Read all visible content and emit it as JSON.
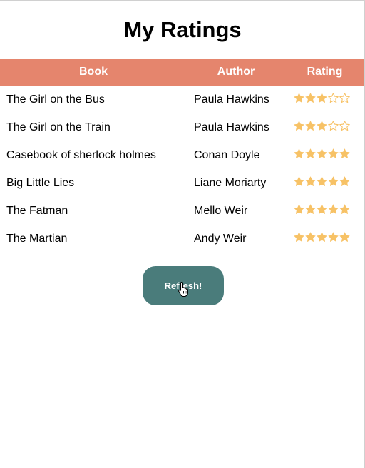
{
  "page": {
    "title": "My Ratings"
  },
  "table": {
    "headers": {
      "book": "Book",
      "author": "Author",
      "rating": "Rating"
    },
    "rows": [
      {
        "book": "The Girl on the Bus",
        "author": "Paula Hawkins",
        "rating": 3,
        "max_rating": 5
      },
      {
        "book": "The Girl on the Train",
        "author": "Paula Hawkins",
        "rating": 3,
        "max_rating": 5
      },
      {
        "book": "Casebook of sherlock holmes",
        "author": "Conan Doyle",
        "rating": 5,
        "max_rating": 5
      },
      {
        "book": "Big Little Lies",
        "author": "Liane Moriarty",
        "rating": 5,
        "max_rating": 5
      },
      {
        "book": "The Fatman",
        "author": "Mello Weir",
        "rating": 5,
        "max_rating": 5
      },
      {
        "book": "The Martian",
        "author": "Andy Weir",
        "rating": 5,
        "max_rating": 5
      }
    ]
  },
  "refresh_button": {
    "label": "Refresh!"
  },
  "icons": {
    "star_filled": "star-filled-icon",
    "star_empty": "star-empty-icon",
    "cursor": "hand-pointer-icon"
  },
  "colors": {
    "header_background": "#e5856d",
    "header_text": "#ffffff",
    "star": "#f7c266",
    "button_background": "#4a7c7b",
    "button_text": "#ffffff"
  }
}
